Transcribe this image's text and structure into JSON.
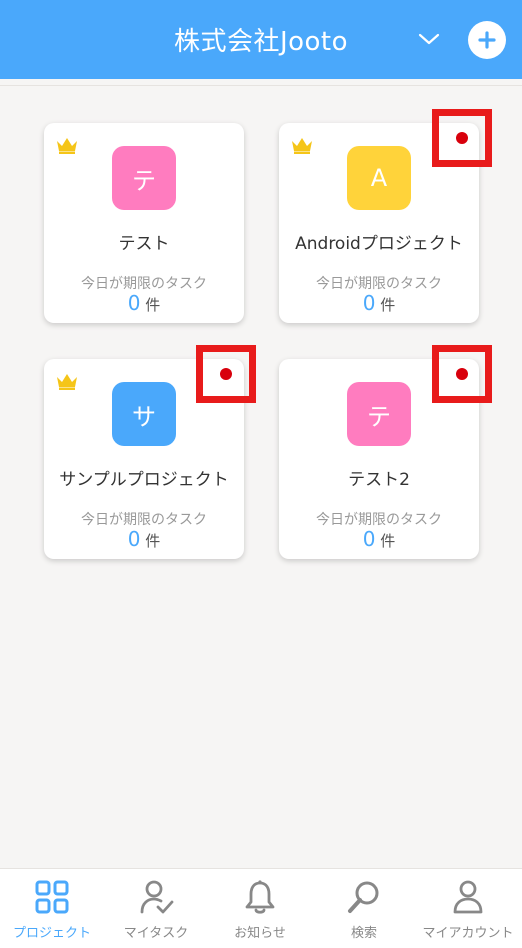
{
  "header": {
    "title": "株式会社Jooto",
    "chevron_icon": "chevron-down-icon",
    "add_icon": "plus-circle-icon"
  },
  "colors": {
    "header": "#4aa8fb",
    "accent": "#4aa8fb",
    "crown": "#f5c518",
    "badge_highlight": "#e81b1b",
    "badge_dot": "#d8000c"
  },
  "projects": [
    {
      "initial": "テ",
      "name": "テスト",
      "avatar_color": "#ff7cbf",
      "owner_crown": true,
      "notification": false,
      "deadline_label": "今日が期限のタスク",
      "count": "0",
      "count_unit": "件"
    },
    {
      "initial": "A",
      "name": "Androidプロジェクト",
      "avatar_color": "#ffd33a",
      "owner_crown": true,
      "notification": true,
      "deadline_label": "今日が期限のタスク",
      "count": "0",
      "count_unit": "件"
    },
    {
      "initial": "サ",
      "name": "サンプルプロジェクト",
      "avatar_color": "#4aa8fb",
      "owner_crown": true,
      "notification": true,
      "deadline_label": "今日が期限のタスク",
      "count": "0",
      "count_unit": "件"
    },
    {
      "initial": "テ",
      "name": "テスト2",
      "avatar_color": "#ff7cbf",
      "owner_crown": false,
      "notification": true,
      "deadline_label": "今日が期限のタスク",
      "count": "0",
      "count_unit": "件"
    }
  ],
  "bottom_nav": [
    {
      "label": "プロジェクト",
      "icon": "grid-icon",
      "active": true
    },
    {
      "label": "マイタスク",
      "icon": "user-check-icon",
      "active": false
    },
    {
      "label": "お知らせ",
      "icon": "bell-icon",
      "active": false
    },
    {
      "label": "検索",
      "icon": "search-icon",
      "active": false
    },
    {
      "label": "マイアカウント",
      "icon": "account-icon",
      "active": false
    }
  ]
}
